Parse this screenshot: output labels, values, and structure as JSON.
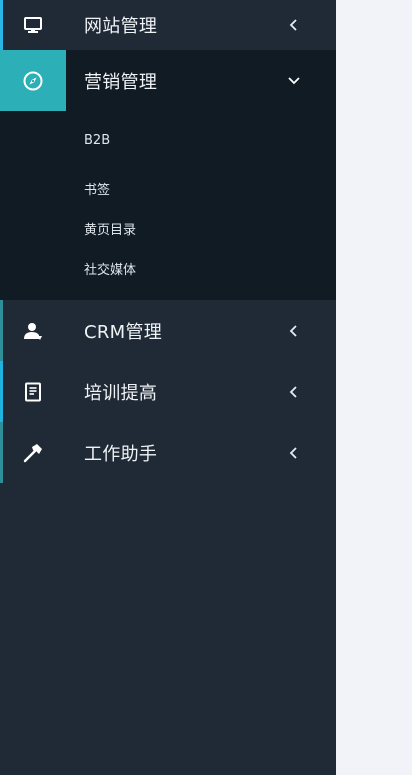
{
  "sidebar": {
    "items": [
      {
        "label": "网站管理",
        "icon": "monitor-icon",
        "accent_color": "#29b6e7",
        "state": "collapsed"
      },
      {
        "label": "营销管理",
        "icon": "compass-icon",
        "accent_color": "#2cafb6",
        "state": "expanded",
        "children": [
          {
            "label": "B2B"
          },
          {
            "label": "书签"
          },
          {
            "label": "黄页目录"
          },
          {
            "label": "社交媒体"
          }
        ]
      },
      {
        "label": "CRM管理",
        "icon": "user-icon",
        "accent_color": "#2e8f99",
        "state": "collapsed"
      },
      {
        "label": "培训提高",
        "icon": "book-icon",
        "accent_color": "#1fb3e0",
        "state": "collapsed"
      },
      {
        "label": "工作助手",
        "icon": "hammer-icon",
        "accent_color": "#2e8f99",
        "state": "collapsed"
      }
    ]
  },
  "colors": {
    "sidebar_bg": "#1f2a36",
    "submenu_bg": "#111b23",
    "active_icon_bg": "#2cafb6",
    "content_bg": "#f1f3f8"
  }
}
